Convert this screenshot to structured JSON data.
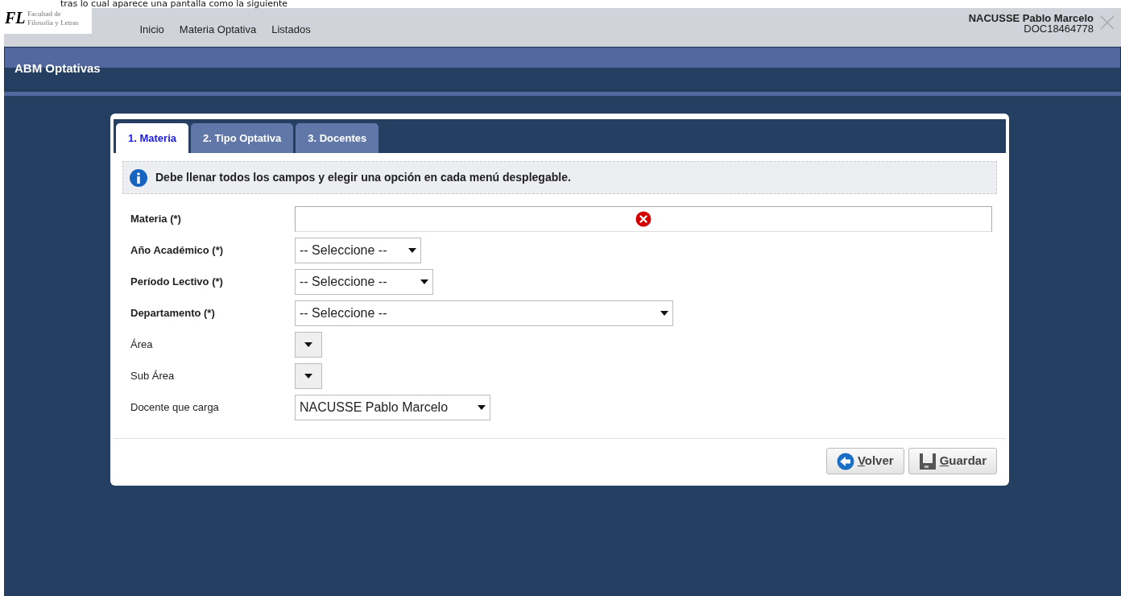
{
  "caption": "tras lo cual aparece una pantalla como la siguiente",
  "header": {
    "logo_mark": "FL",
    "logo_lines": [
      "Facultad de",
      "Filosofía y Letras"
    ],
    "nav": [
      "Inicio",
      "Materia Optativa",
      "Listados"
    ],
    "user": {
      "name": "NACUSSE Pablo Marcelo",
      "id": "DOC18464778"
    }
  },
  "page_title": "ABM Optativas",
  "tabs": [
    {
      "label": "1. Materia",
      "selected": true
    },
    {
      "label": "2. Tipo Optativa",
      "selected": false
    },
    {
      "label": "3. Docentes",
      "selected": false
    }
  ],
  "info_message": "Debe llenar todos los campos y elegir una opción en cada menú desplegable.",
  "fields": [
    {
      "label": "Materia (*)",
      "required": true,
      "kind": "text",
      "error": true
    },
    {
      "label": "Año Académico (*)",
      "required": true,
      "kind": "select",
      "value": "-- Seleccione --"
    },
    {
      "label": "Período Lectivo (*)",
      "required": true,
      "kind": "select",
      "value": "-- Seleccione --"
    },
    {
      "label": "Departamento (*)",
      "required": true,
      "kind": "select",
      "value": "-- Seleccione --"
    },
    {
      "label": "Área",
      "required": false,
      "kind": "select"
    },
    {
      "label": "Sub Área",
      "required": false,
      "kind": "select"
    },
    {
      "label": "Docente que carga",
      "required": false,
      "kind": "select",
      "value": "NACUSSE Pablo Marcelo"
    }
  ],
  "buttons": [
    {
      "label": "Volver",
      "kind": "back"
    },
    {
      "label": "Guardar",
      "kind": "save"
    }
  ]
}
